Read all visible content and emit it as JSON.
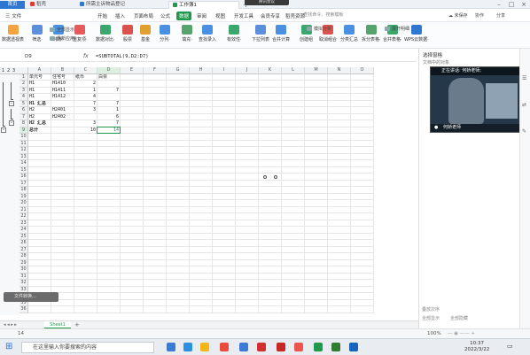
{
  "title_tabs": {
    "home": "首页",
    "t1": "稻壳",
    "t2": "所需主诉物品登记",
    "t3": "工作簿1",
    "meeting": "腾讯会议"
  },
  "menu": {
    "file": "三 文件",
    "items": [
      "开始",
      "插入",
      "页面布局",
      "公式",
      "数据",
      "审阅",
      "视图",
      "开发工具",
      "会员专享",
      "稻壳资源"
    ],
    "active_index": 4,
    "search_placeholder": "查找命令、搜索模板",
    "saved": "未保存",
    "collab": "协作",
    "share": "分享"
  },
  "ribbon": {
    "big": [
      "数据透视表",
      "筛选·",
      "排序·",
      "重复项·",
      "数据对比·",
      "股票",
      "基金",
      "分列·",
      "填充·",
      "查找录入",
      "有效性·",
      "下拉列表",
      "合并计算",
      "创建组",
      "取消组合",
      "分类汇总",
      "拆分表格·",
      "合并表格·",
      "WPS云数据·"
    ],
    "small_top": [
      "全部显示",
      "重新应用",
      "模拟分析",
      "展开明细"
    ],
    "small_bottom": [
      "重新应用",
      "记录单",
      "折叠明细"
    ]
  },
  "formula_bar": {
    "namebox": "D9",
    "fx": "fx",
    "formula": "=SUBTOTAL(9,D2:D7)"
  },
  "grid": {
    "columns": [
      "A",
      "B",
      "C",
      "D",
      "E",
      "F",
      "G",
      "H",
      "I",
      "J",
      "K",
      "L",
      "M",
      "N",
      "O"
    ],
    "row_count": 36,
    "outline_levels": [
      "1",
      "2",
      "3"
    ],
    "cells": [
      {
        "r": 1,
        "c": 0,
        "v": "单元号"
      },
      {
        "r": 1,
        "c": 1,
        "v": "住宅号"
      },
      {
        "r": 1,
        "c": 2,
        "v": "纸币"
      },
      {
        "r": 1,
        "c": 3,
        "v": "白票"
      },
      {
        "r": 2,
        "c": 0,
        "v": "H1"
      },
      {
        "r": 2,
        "c": 1,
        "v": "H1410"
      },
      {
        "r": 2,
        "c": 2,
        "v": "2",
        "n": true
      },
      {
        "r": 3,
        "c": 0,
        "v": "H1"
      },
      {
        "r": 3,
        "c": 1,
        "v": "H1411"
      },
      {
        "r": 3,
        "c": 2,
        "v": "1",
        "n": true
      },
      {
        "r": 3,
        "c": 3,
        "v": "7",
        "n": true
      },
      {
        "r": 4,
        "c": 0,
        "v": "H1"
      },
      {
        "r": 4,
        "c": 1,
        "v": "H1412"
      },
      {
        "r": 4,
        "c": 2,
        "v": "4",
        "n": true
      },
      {
        "r": 5,
        "c": 0,
        "v": "H1 汇总",
        "b": true
      },
      {
        "r": 5,
        "c": 2,
        "v": "7",
        "n": true
      },
      {
        "r": 5,
        "c": 3,
        "v": "7",
        "n": true
      },
      {
        "r": 6,
        "c": 0,
        "v": "H2"
      },
      {
        "r": 6,
        "c": 1,
        "v": "H2401"
      },
      {
        "r": 6,
        "c": 2,
        "v": "3",
        "n": true
      },
      {
        "r": 6,
        "c": 3,
        "v": "1",
        "n": true
      },
      {
        "r": 7,
        "c": 0,
        "v": "H2"
      },
      {
        "r": 7,
        "c": 1,
        "v": "H2402"
      },
      {
        "r": 7,
        "c": 3,
        "v": "6",
        "n": true
      },
      {
        "r": 8,
        "c": 0,
        "v": "H2 汇总",
        "b": true
      },
      {
        "r": 8,
        "c": 2,
        "v": "3",
        "n": true
      },
      {
        "r": 8,
        "c": 3,
        "v": "7",
        "n": true
      },
      {
        "r": 9,
        "c": 0,
        "v": "总计",
        "b": true
      },
      {
        "r": 9,
        "c": 2,
        "v": "10",
        "n": true
      },
      {
        "r": 9,
        "c": 3,
        "v": "14",
        "n": true
      }
    ]
  },
  "sheet": {
    "name": "Sheet1"
  },
  "status": {
    "left": "14",
    "zoom": "100%"
  },
  "pane": {
    "title": "选择窗格",
    "subtitle": "文档中的对象",
    "speaking": "正在讲话: 何娇老师;",
    "presenter": "何娇老师",
    "order_label": "叠放次序",
    "show_all": "全部显示",
    "hide_all": "全部隐藏"
  },
  "left_tool": "文件转换...",
  "taskbar": {
    "search": "在这里输入你要搜索的内容",
    "time": "10:37",
    "date": "2022/3/22"
  },
  "colors": {
    "accent": "#1f9a4d",
    "home_tab": "#2f78d1"
  }
}
